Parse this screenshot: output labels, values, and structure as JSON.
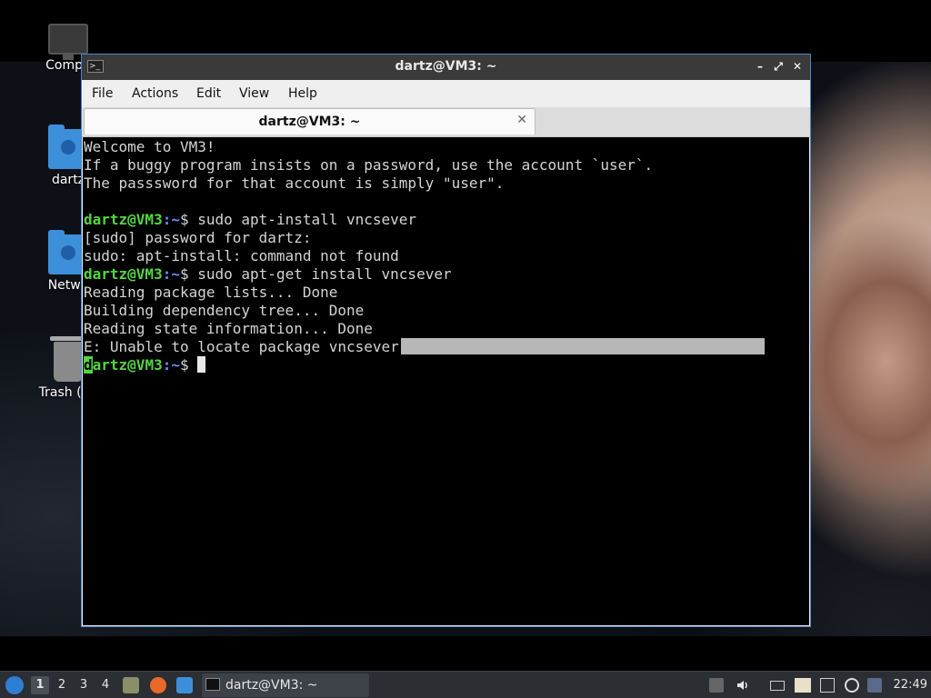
{
  "desktop": {
    "icons": [
      {
        "name": "computer",
        "label": "Compu"
      },
      {
        "name": "home",
        "label": "dartz"
      },
      {
        "name": "network",
        "label": "Netwo"
      },
      {
        "name": "trash",
        "label": "Trash (En"
      }
    ]
  },
  "window": {
    "title": "dartz@VM3: ~",
    "controls": {
      "minimize": "–",
      "maximize": "⤢",
      "close": "✕"
    },
    "menu": [
      "File",
      "Actions",
      "Edit",
      "View",
      "Help"
    ],
    "tab": {
      "label": "dartz@VM3: ~",
      "close": "✕"
    }
  },
  "terminal": {
    "welcome": [
      "Welcome to VM3!",
      "If a buggy program insists on a password, use the account `user`.",
      "The passsword for that account is simply \"user\"."
    ],
    "prompt_user": "dartz@VM3",
    "prompt_path": ":~",
    "prompt_symbol": "$",
    "command1": " sudo apt-install vncsever",
    "output1": [
      "[sudo] password for dartz:",
      "sudo: apt-install: command not found"
    ],
    "command2": " sudo apt-get install vncsever",
    "output2": [
      "Reading package lists... Done",
      "Building dependency tree... Done",
      "Reading state information... Done",
      "E: Unable to locate package vncsever"
    ],
    "prompt3_first_char": "d",
    "prompt3_rest": "artz@VM3"
  },
  "taskbar": {
    "workspaces": [
      "1",
      "2",
      "3",
      "4"
    ],
    "active_workspace": "1",
    "task_label": "dartz@VM3: ~",
    "clock": "22:49"
  },
  "colors": {
    "prompt_user": "#53d640",
    "prompt_path": "#6a8dff",
    "window_border": "#4a86c5",
    "taskbar_bg": "#2b2e33"
  }
}
